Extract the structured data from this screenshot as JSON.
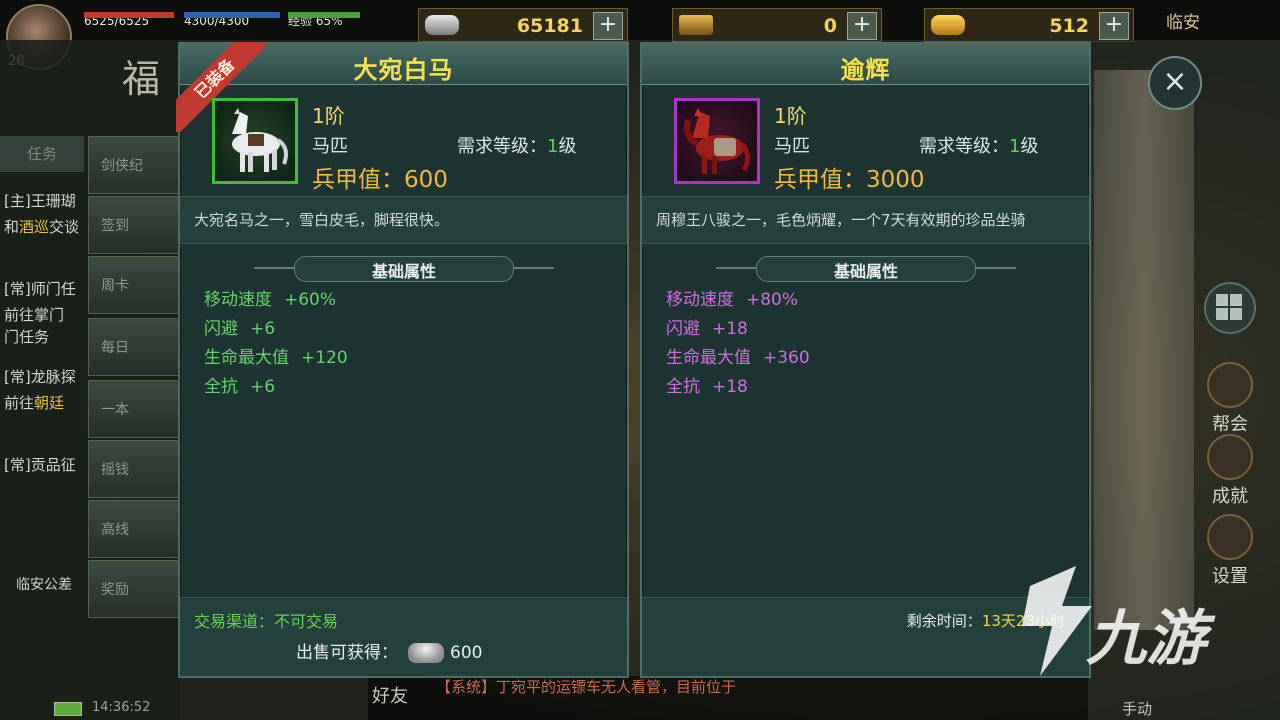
{
  "hud": {
    "hp": "6525/6525",
    "mp": "4300/4300",
    "xp": "经验 65%",
    "xp_fraction": 0.65,
    "player_level": "28",
    "currencies": [
      {
        "value": "65181",
        "plus": "+"
      },
      {
        "value": "0",
        "plus": "+"
      },
      {
        "value": "512",
        "plus": "+"
      }
    ],
    "location": "临安",
    "clock": "14:36:52"
  },
  "left_ui": {
    "fortune_char": "福",
    "tasks_tab": "任务",
    "quest_lines": [
      {
        "text": "[主]王珊瑚"
      },
      {
        "text": "和",
        "hl": "酒巡",
        "rest": "交谈"
      },
      {
        "text": "[常]师门任"
      },
      {
        "text": "前往掌门"
      },
      {
        "text": "门任务"
      },
      {
        "text": "[常]龙脉探"
      },
      {
        "text": "前往",
        "hl": "朝廷"
      },
      {
        "text": "[常]贡品征"
      }
    ],
    "side_tabs": [
      "剑侠纪",
      "签到",
      "周卡",
      "每日",
      "一本",
      "摇钱",
      "高线",
      "奖励"
    ],
    "bottom_label": "临安公差"
  },
  "right_ui": {
    "close_label": "×",
    "buttons": [
      "帮会",
      "成就",
      "设置"
    ],
    "bottom_buttons": [
      "手动"
    ]
  },
  "chat": {
    "friend_label": "好友",
    "message": "【系统】丁宛平的运镖车无人看管，目前位于"
  },
  "items": [
    {
      "name": "大宛白马",
      "ribbon": "已装备",
      "tier": "1阶",
      "type": "马匹",
      "req_label": "需求等级：",
      "req_level": "1",
      "req_unit": "级",
      "armor": "兵甲值：600",
      "desc": "大宛名马之一，雪白皮毛，脚程很快。",
      "attr_header": "基础属性",
      "attrs": [
        {
          "name": "移动速度",
          "value": "+60%"
        },
        {
          "name": "闪避",
          "value": "+6"
        },
        {
          "name": "生命最大值",
          "value": "+120"
        },
        {
          "name": "全抗",
          "value": "+6"
        }
      ],
      "trade": "交易渠道：不可交易",
      "sell_label": "出售可获得：",
      "sell_value": "600",
      "quality_color": "#3ebd3a",
      "attr_color": "#67d06a"
    },
    {
      "name": "逾辉",
      "tier": "1阶",
      "type": "马匹",
      "req_label": "需求等级：",
      "req_level": "1",
      "req_unit": "级",
      "armor": "兵甲值：3000",
      "desc": "周穆王八骏之一，毛色炳耀，一个7天有效期的珍品坐骑",
      "attr_header": "基础属性",
      "attrs": [
        {
          "name": "移动速度",
          "value": "+80%"
        },
        {
          "name": "闪避",
          "value": "+18"
        },
        {
          "name": "生命最大值",
          "value": "+360"
        },
        {
          "name": "全抗",
          "value": "+18"
        }
      ],
      "remain_label": "剩余时间：",
      "remain_value": "13天23小时",
      "quality_color": "#a935c9",
      "attr_color": "#cc6fe0"
    }
  ],
  "watermark": {
    "text": "九游"
  }
}
